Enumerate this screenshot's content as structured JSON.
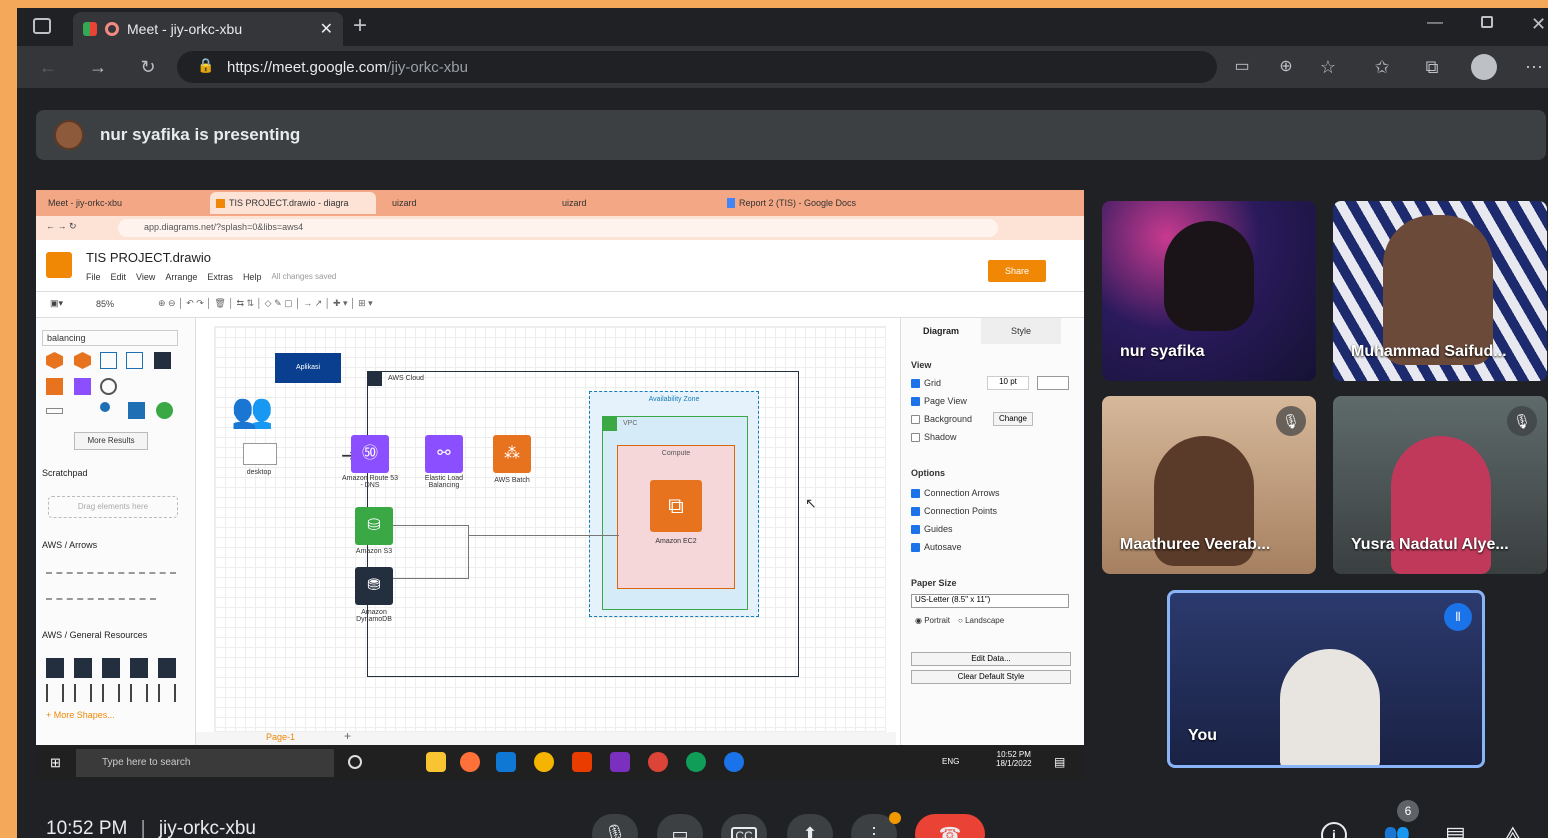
{
  "browser": {
    "tab_title": "Meet - jiy-orkc-xbu",
    "url_host": "https://meet.google.com",
    "url_path": "/jiy-orkc-xbu"
  },
  "meet": {
    "presenting_text": "nur syafika is presenting",
    "time": "10:52 PM",
    "separator": "|",
    "meeting_code": "jiy-orkc-xbu",
    "participant_count": "6",
    "participants": [
      {
        "name": "nur syafika"
      },
      {
        "name": "Muhammad Saifud..."
      },
      {
        "name": "Maathuree Veerab..."
      },
      {
        "name": "Yusra Nadatul Alye..."
      },
      {
        "name": "You"
      }
    ]
  },
  "drawio": {
    "browser_tabs": [
      "Meet - jiy-orkc-xbu",
      "TIS PROJECT.drawio - diagra",
      "uizard",
      "uizard",
      "Report 2 (TIS) - Google Docs"
    ],
    "url": "app.diagrams.net/?splash=0&libs=aws4",
    "file_title": "TIS PROJECT.drawio",
    "menus": [
      "File",
      "Edit",
      "View",
      "Arrange",
      "Extras",
      "Help"
    ],
    "saved_status": "All changes saved",
    "share_label": "Share",
    "zoom": "85%",
    "search_value": "balancing",
    "more_results": "More Results",
    "scratchpad": "Scratchpad",
    "drag_hint": "Drag elements here",
    "sections": [
      "AWS / Arrows",
      "AWS / General Resources"
    ],
    "more_shapes": "+ More Shapes...",
    "page_tab": "Page-1",
    "canvas": {
      "title_box": "Aplikasi",
      "aws_cloud": "AWS Cloud",
      "availability_zone": "Availability Zone",
      "vpc": "VPC",
      "compute": "Compute",
      "desktop": "desktop",
      "services": [
        "Amazon Route 53 - DNS",
        "Elastic Load Balancing",
        "AWS Batch",
        "Amazon EC2",
        "Amazon S3",
        "Amazon DynamoDB"
      ]
    },
    "panel": {
      "tabs": [
        "Diagram",
        "Style"
      ],
      "view_heading": "View",
      "view_options": [
        {
          "label": "Grid",
          "checked": true
        },
        {
          "label": "Page View",
          "checked": true
        },
        {
          "label": "Background",
          "checked": false
        },
        {
          "label": "Shadow",
          "checked": false
        }
      ],
      "grid_size": "10 pt",
      "change_label": "Change",
      "options_heading": "Options",
      "options": [
        {
          "label": "Connection Arrows",
          "checked": true
        },
        {
          "label": "Connection Points",
          "checked": true
        },
        {
          "label": "Guides",
          "checked": true
        },
        {
          "label": "Autosave",
          "checked": true
        }
      ],
      "paper_size_heading": "Paper Size",
      "paper_size": "US-Letter (8.5\" x 11\")",
      "portrait": "Portrait",
      "landscape": "Landscape",
      "edit_data": "Edit Data...",
      "clear_style": "Clear Default Style"
    },
    "taskbar": {
      "search": "Type here to search",
      "lang": "ENG",
      "time": "10:52 PM",
      "date": "18/1/2022"
    }
  }
}
